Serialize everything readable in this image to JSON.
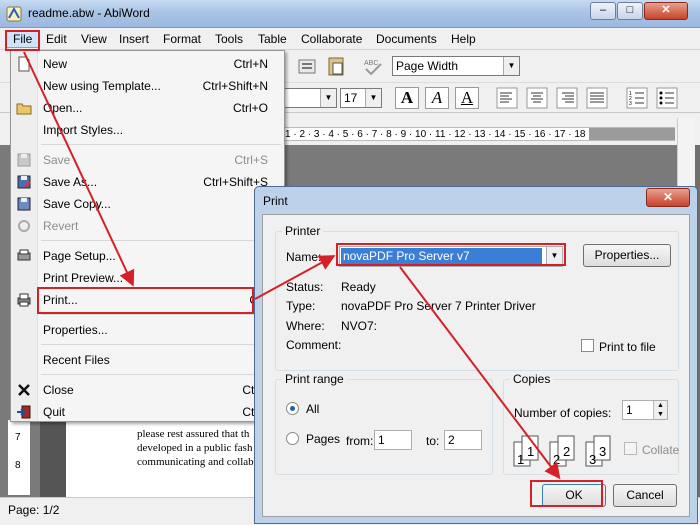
{
  "window": {
    "title": "readme.abw - AbiWord",
    "min_glyph": "‒",
    "max_glyph": "□",
    "close_glyph": "✕"
  },
  "menubar": [
    "File",
    "Edit",
    "View",
    "Insert",
    "Format",
    "Tools",
    "Table",
    "Collaborate",
    "Documents",
    "Help"
  ],
  "toolbar": {
    "zoom_value": "Page Width",
    "font_size_value": "17",
    "bold_glyph": "A",
    "italic_glyph": "A",
    "underline_glyph": "A"
  },
  "ruler": {
    "text": "1 · 2 · 3 · 4 · 5 · 6 · 7 · 8 · 9 · 10 · 11 · 12 · 13 · 14 · 15 · 16 · 17 · 18 ·"
  },
  "document": {
    "lines": [
      "please rest assured that th",
      "developed in a public fash",
      "communicating and collab"
    ],
    "left_ruler": [
      "7",
      "8"
    ]
  },
  "status": {
    "page": "Page: 1/2"
  },
  "file_menu": {
    "items": [
      {
        "label": "New",
        "shortcut": "Ctrl+N",
        "disabled": false
      },
      {
        "label": "New using Template...",
        "shortcut": "Ctrl+Shift+N",
        "disabled": false
      },
      {
        "label": "Open...",
        "shortcut": "Ctrl+O",
        "disabled": false
      },
      {
        "label": "Import Styles...",
        "shortcut": "",
        "disabled": false
      },
      {
        "label": "Save",
        "shortcut": "Ctrl+S",
        "disabled": true
      },
      {
        "label": "Save As...",
        "shortcut": "Ctrl+Shift+S",
        "disabled": false
      },
      {
        "label": "Save Copy...",
        "shortcut": "",
        "disabled": false
      },
      {
        "label": "Revert",
        "shortcut": "",
        "disabled": true
      },
      {
        "label": "Page Setup...",
        "shortcut": "",
        "disabled": false
      },
      {
        "label": "Print Preview...",
        "shortcut": "",
        "disabled": false
      },
      {
        "label": "Print...",
        "shortcut": "Ctrl",
        "disabled": false
      },
      {
        "label": "Properties...",
        "shortcut": "",
        "disabled": false
      },
      {
        "label": "Recent Files",
        "shortcut": "",
        "disabled": false
      },
      {
        "label": "Close",
        "shortcut": "Ctrl+",
        "disabled": false
      },
      {
        "label": "Quit",
        "shortcut": "Ctrl+",
        "disabled": false
      }
    ]
  },
  "print_dialog": {
    "title": "Print",
    "close_glyph": "✕",
    "printer_group": "Printer",
    "name_label": "Name:",
    "printer_name": "novaPDF Pro Server v7",
    "properties_button": "Properties...",
    "status_label": "Status:",
    "status_value": "Ready",
    "type_label": "Type:",
    "type_value": "novaPDF Pro Server 7 Printer Driver",
    "where_label": "Where:",
    "where_value": "NVO7:",
    "comment_label": "Comment:",
    "print_to_file": "Print to file",
    "range_group": "Print range",
    "all_label": "All",
    "pages_label": "Pages",
    "from_label": "from:",
    "from_value": "1",
    "to_label": "to:",
    "to_value": "2",
    "copies_group": "Copies",
    "copies_label": "Number of copies:",
    "copies_value": "1",
    "collate_label": "Collate",
    "collate_icons": [
      "1",
      "1",
      "2",
      "2",
      "3",
      "3"
    ],
    "ok_button": "OK",
    "cancel_button": "Cancel"
  },
  "colors": {
    "highlight": "#d42027",
    "selection": "#3a7fd5"
  }
}
